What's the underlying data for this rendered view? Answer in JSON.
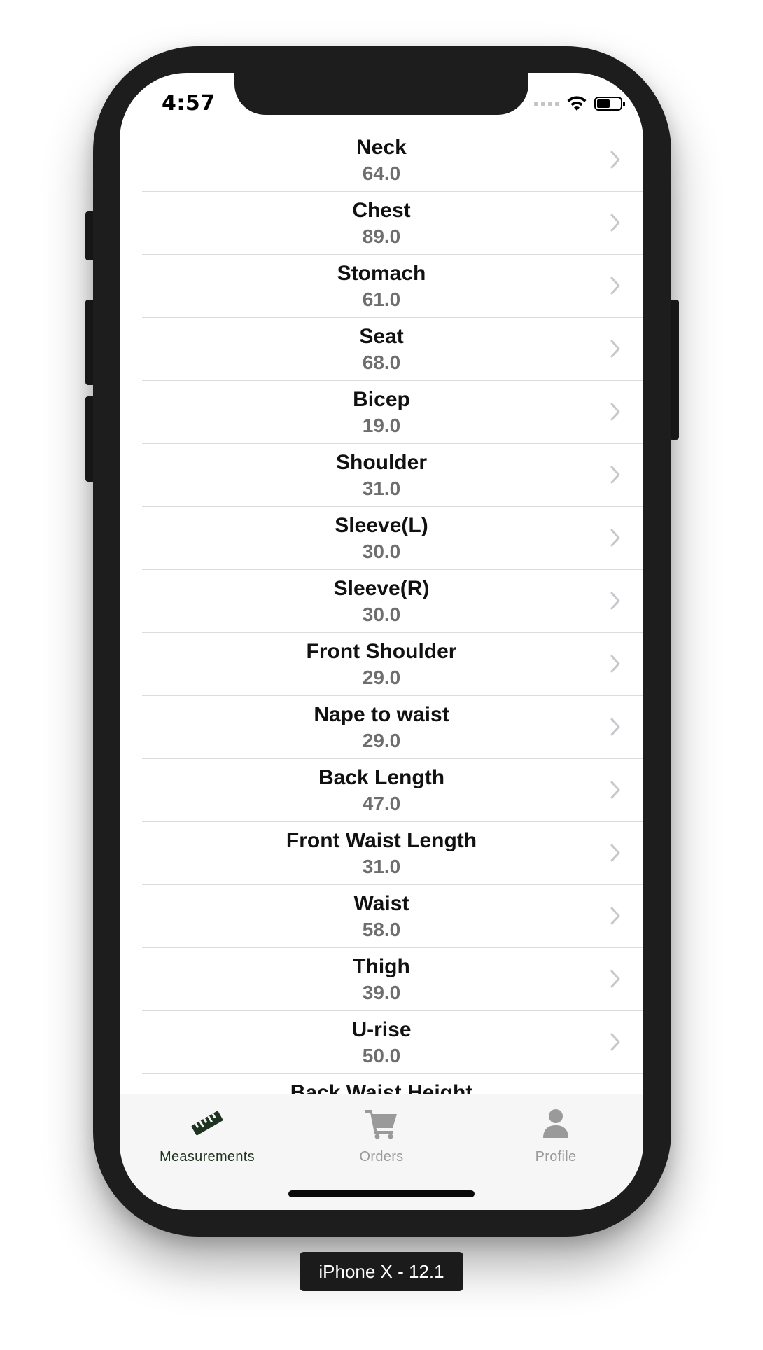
{
  "status_bar": {
    "time": "4:57",
    "battery_level": 0.55,
    "icons": [
      "cellular-dots-icon",
      "wifi-icon",
      "battery-icon"
    ]
  },
  "measurements": {
    "items": [
      {
        "name": "Neck",
        "value": "64.0"
      },
      {
        "name": "Chest",
        "value": "89.0"
      },
      {
        "name": "Stomach",
        "value": "61.0"
      },
      {
        "name": "Seat",
        "value": "68.0"
      },
      {
        "name": "Bicep",
        "value": "19.0"
      },
      {
        "name": "Shoulder",
        "value": "31.0"
      },
      {
        "name": "Sleeve(L)",
        "value": "30.0"
      },
      {
        "name": "Sleeve(R)",
        "value": "30.0"
      },
      {
        "name": "Front Shoulder",
        "value": "29.0"
      },
      {
        "name": "Nape to waist",
        "value": "29.0"
      },
      {
        "name": "Back Length",
        "value": "47.0"
      },
      {
        "name": "Front Waist Length",
        "value": "31.0"
      },
      {
        "name": "Waist",
        "value": "58.0"
      },
      {
        "name": "Thigh",
        "value": "39.0"
      },
      {
        "name": "U-rise",
        "value": "50.0"
      },
      {
        "name": "Back Waist Height",
        "value": ""
      }
    ]
  },
  "tabbar": {
    "tabs": [
      {
        "label": "Measurements",
        "icon": "ruler-icon",
        "active": true
      },
      {
        "label": "Orders",
        "icon": "cart-icon",
        "active": false
      },
      {
        "label": "Profile",
        "icon": "person-icon",
        "active": false
      }
    ]
  },
  "colors": {
    "active_tab": "#1f3321",
    "inactive_tab": "#9a9a9a",
    "value_text": "#6e6e6e",
    "device_frame": "#1d1d1d"
  },
  "device_label": "iPhone X - 12.1"
}
